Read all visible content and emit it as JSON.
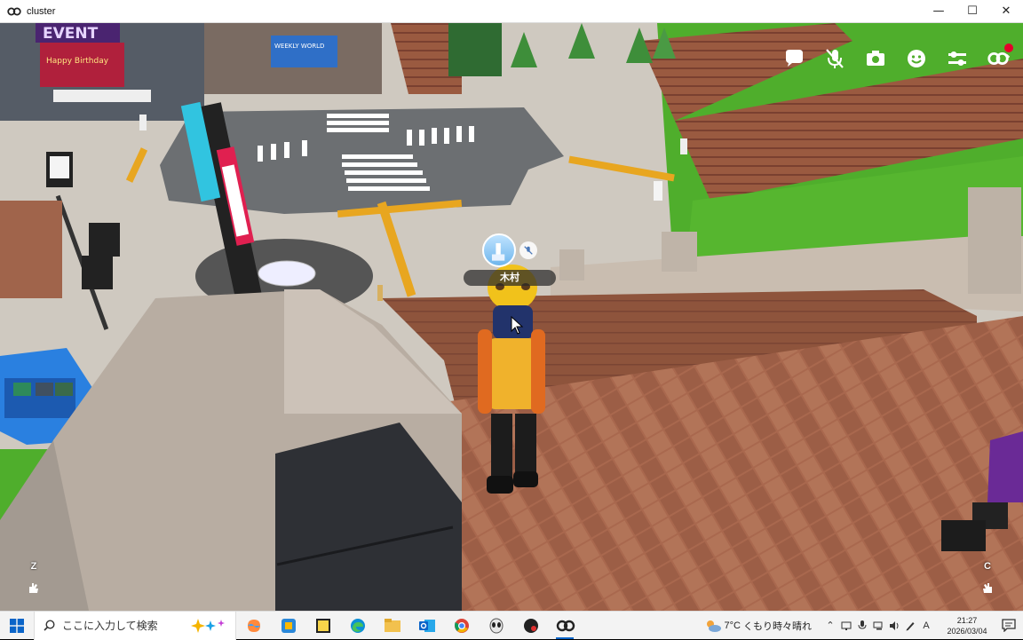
{
  "window": {
    "title": "cluster",
    "controls": [
      "—",
      "☐",
      "✕"
    ]
  },
  "scene": {
    "signs": {
      "event": "EVENT",
      "birthday": "Happy Birthday",
      "weekly": "WEEKLY WORLD"
    }
  },
  "hud": {
    "buttons": [
      "chat",
      "mic-muted",
      "camera",
      "emote",
      "settings",
      "cluster-menu"
    ],
    "nameplate": {
      "name": "木村"
    },
    "left_key": "Z",
    "right_key": "C"
  },
  "taskbar": {
    "search_placeholder": "ここに入力して検索",
    "apps": [
      "copilot",
      "app-2",
      "sticky-notes",
      "edge",
      "file-explorer",
      "outlook",
      "chrome",
      "app-alien",
      "app-dark",
      "cluster"
    ],
    "weather": {
      "temp": "7°C",
      "desc": "くもり時々晴れ"
    },
    "ime": "A",
    "time": "21:27",
    "date": "2026/03/04"
  },
  "colors": {
    "accent": "#0a64c8",
    "notify": "#e4002b",
    "grass": "#4caf2a",
    "brick": "#a8644a"
  }
}
